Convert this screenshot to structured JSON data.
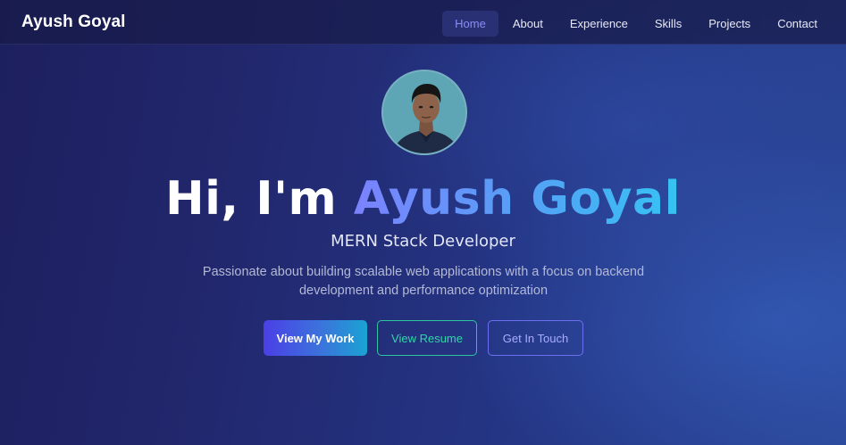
{
  "navbar": {
    "brand": "Ayush Goyal",
    "links": [
      {
        "label": "Home",
        "active": true
      },
      {
        "label": "About",
        "active": false
      },
      {
        "label": "Experience",
        "active": false
      },
      {
        "label": "Skills",
        "active": false
      },
      {
        "label": "Projects",
        "active": false
      },
      {
        "label": "Contact",
        "active": false
      }
    ]
  },
  "hero": {
    "avatar": "profile-photo",
    "greeting": "Hi, I'm",
    "name": "Ayush Goyal",
    "subtitle": "MERN Stack Developer",
    "description": "Passionate about building scalable web applications with a focus on backend development and performance optimization",
    "buttons": {
      "work": "View My Work",
      "resume": "View Resume",
      "contact": "Get In Touch"
    }
  },
  "colors": {
    "accent_purple": "#8b8cf6",
    "name_gradient_start": "#7b82ff",
    "name_gradient_end": "#35c3f3",
    "resume_green": "#2fc69f",
    "contact_purple": "#6d6ff0"
  }
}
